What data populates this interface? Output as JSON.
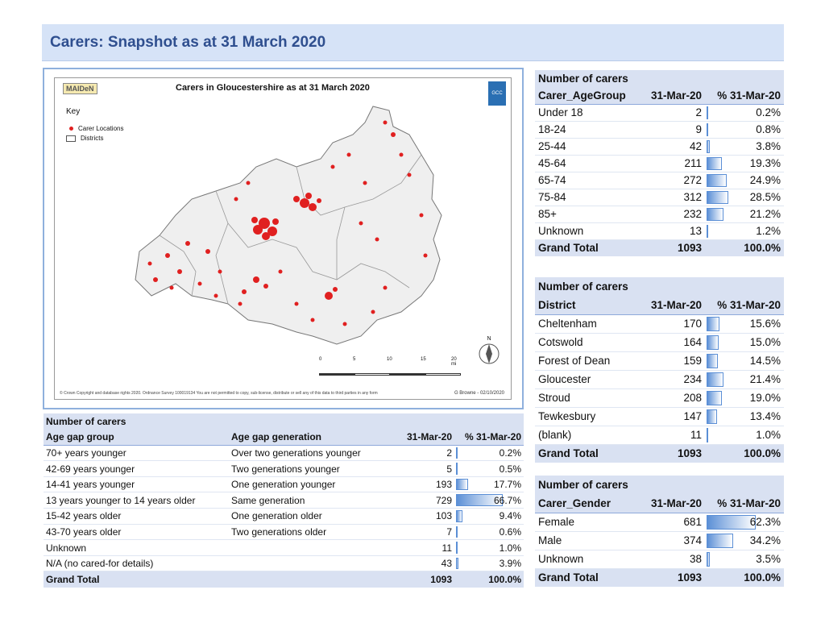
{
  "header": {
    "title": "Carers: Snapshot as at 31 March 2020"
  },
  "map": {
    "title": "Carers in Gloucestershire as at 31 March 2020",
    "logo_left": "MAIDeN",
    "logo_right": "GCC",
    "key_title": "Key",
    "key_items": [
      "Carer Locations",
      "Districts"
    ],
    "scale_labels": [
      "0",
      "5",
      "10",
      "15",
      "20 mi"
    ],
    "north_label": "N",
    "footer_left": "© Crown Copyright and database rights 2020. Ordnance Survey 100019134    You are not permitted to copy, sub-license, distribute or sell any of this data to third parties in any form",
    "footer_right": "G Browne - 02/10/2020"
  },
  "age_table": {
    "caption": "Number of carers",
    "col1": "Carer_AgeGroup",
    "col2": "31-Mar-20",
    "col3": "% 31-Mar-20",
    "rows": [
      {
        "label": "Under 18",
        "count": "2",
        "pct": "0.2%",
        "frac": 0.002
      },
      {
        "label": "18-24",
        "count": "9",
        "pct": "0.8%",
        "frac": 0.008
      },
      {
        "label": "25-44",
        "count": "42",
        "pct": "3.8%",
        "frac": 0.038
      },
      {
        "label": "45-64",
        "count": "211",
        "pct": "19.3%",
        "frac": 0.193
      },
      {
        "label": "65-74",
        "count": "272",
        "pct": "24.9%",
        "frac": 0.249
      },
      {
        "label": "75-84",
        "count": "312",
        "pct": "28.5%",
        "frac": 0.285
      },
      {
        "label": "85+",
        "count": "232",
        "pct": "21.2%",
        "frac": 0.212
      },
      {
        "label": "Unknown",
        "count": "13",
        "pct": "1.2%",
        "frac": 0.012
      }
    ],
    "total_label": "Grand Total",
    "total_count": "1093",
    "total_pct": "100.0%"
  },
  "district_table": {
    "caption": "Number of carers",
    "col1": "District",
    "col2": "31-Mar-20",
    "col3": "% 31-Mar-20",
    "rows": [
      {
        "label": "Cheltenham",
        "count": "170",
        "pct": "15.6%",
        "frac": 0.156
      },
      {
        "label": "Cotswold",
        "count": "164",
        "pct": "15.0%",
        "frac": 0.15
      },
      {
        "label": "Forest of Dean",
        "count": "159",
        "pct": "14.5%",
        "frac": 0.145
      },
      {
        "label": "Gloucester",
        "count": "234",
        "pct": "21.4%",
        "frac": 0.214
      },
      {
        "label": "Stroud",
        "count": "208",
        "pct": "19.0%",
        "frac": 0.19
      },
      {
        "label": "Tewkesbury",
        "count": "147",
        "pct": "13.4%",
        "frac": 0.134
      },
      {
        "label": "(blank)",
        "count": "11",
        "pct": "1.0%",
        "frac": 0.01
      }
    ],
    "total_label": "Grand Total",
    "total_count": "1093",
    "total_pct": "100.0%"
  },
  "gender_table": {
    "caption": "Number of carers",
    "col1": "Carer_Gender",
    "col2": "31-Mar-20",
    "col3": "% 31-Mar-20",
    "rows": [
      {
        "label": "Female",
        "count": "681",
        "pct": "62.3%",
        "frac": 0.623
      },
      {
        "label": "Male",
        "count": "374",
        "pct": "34.2%",
        "frac": 0.342
      },
      {
        "label": "Unknown",
        "count": "38",
        "pct": "3.5%",
        "frac": 0.035
      }
    ],
    "total_label": "Grand Total",
    "total_count": "1093",
    "total_pct": "100.0%"
  },
  "agegap_table": {
    "caption": "Number of carers",
    "col1": "Age gap group",
    "col2": "Age gap generation",
    "col3": "31-Mar-20",
    "col4": "% 31-Mar-20",
    "rows": [
      {
        "group": "70+ years younger",
        "gen": "Over two generations younger",
        "count": "2",
        "pct": "0.2%",
        "frac": 0.002
      },
      {
        "group": "42-69 years younger",
        "gen": "Two generations younger",
        "count": "5",
        "pct": "0.5%",
        "frac": 0.005
      },
      {
        "group": "14-41 years younger",
        "gen": "One generation younger",
        "count": "193",
        "pct": "17.7%",
        "frac": 0.177
      },
      {
        "group": "13 years younger to 14 years older",
        "gen": "Same generation",
        "count": "729",
        "pct": "66.7%",
        "frac": 0.667
      },
      {
        "group": "15-42 years older",
        "gen": "One generation older",
        "count": "103",
        "pct": "9.4%",
        "frac": 0.094
      },
      {
        "group": "43-70 years older",
        "gen": "Two generations older",
        "count": "7",
        "pct": "0.6%",
        "frac": 0.006
      },
      {
        "group": "Unknown",
        "gen": "",
        "count": "11",
        "pct": "1.0%",
        "frac": 0.01
      },
      {
        "group": "N/A (no cared-for details)",
        "gen": "",
        "count": "43",
        "pct": "3.9%",
        "frac": 0.039
      }
    ],
    "total_label": "Grand Total",
    "total_count": "1093",
    "total_pct": "100.0%"
  },
  "colors": {
    "accent": "#2f4f8f",
    "header_bg": "#d6e3f7",
    "table_header": "#d9e1f2",
    "bar": "#5b8fd6",
    "dot": "#e02020"
  }
}
